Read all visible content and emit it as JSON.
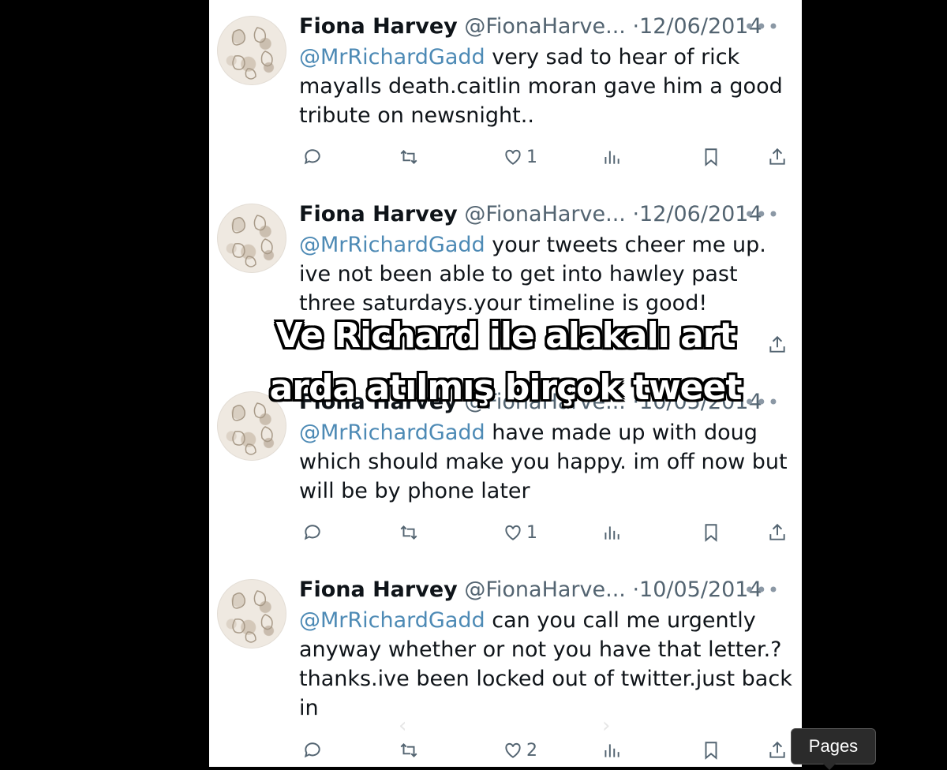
{
  "tweets": [
    {
      "name": "Fiona Harvey",
      "handle": "@FionaHarve...",
      "date": "12/06/2014",
      "mention": "@MrRichardGadd",
      "text": " very sad to hear of rick mayalls death.caitlin moran gave him a good tribute on newsnight..",
      "likes": "1"
    },
    {
      "name": "Fiona Harvey",
      "handle": "@FionaHarve...",
      "date": "12/06/2014",
      "mention": "@MrRichardGadd",
      "text": " your tweets cheer me up. ive not been able to get into hawley past three saturdays.your timeline is good!",
      "likes": ""
    },
    {
      "name": "Fiona Harvey",
      "handle": "@FionaHarve...",
      "date": "10/05/2014",
      "mention": "@MrRichardGadd",
      "text": " have made up with doug which should make you happy. im off now but will be by phone later",
      "likes": "1"
    },
    {
      "name": "Fiona Harvey",
      "handle": "@FionaHarve...",
      "date": "10/05/2014",
      "mention": "@MrRichardGadd",
      "text": " can you call me urgently anyway whether or not you have that letter.? thanks.ive been locked out of twitter.just back in",
      "likes": "2"
    }
  ],
  "separator": "·",
  "more_glyph": "•••",
  "overlay_caption": {
    "line1": "Ve Richard ile alakalı art",
    "line2": "arda atılmış birçok tweet"
  },
  "tooltip": "Pages",
  "nav": {
    "prev": "‹",
    "next": "›"
  },
  "icons": [
    "reply-icon",
    "retweet-icon",
    "like-icon",
    "views-icon",
    "bookmark-icon",
    "share-icon"
  ],
  "colors": {
    "mention": "#4d8ab5",
    "muted": "#536471",
    "background": "#000000"
  }
}
